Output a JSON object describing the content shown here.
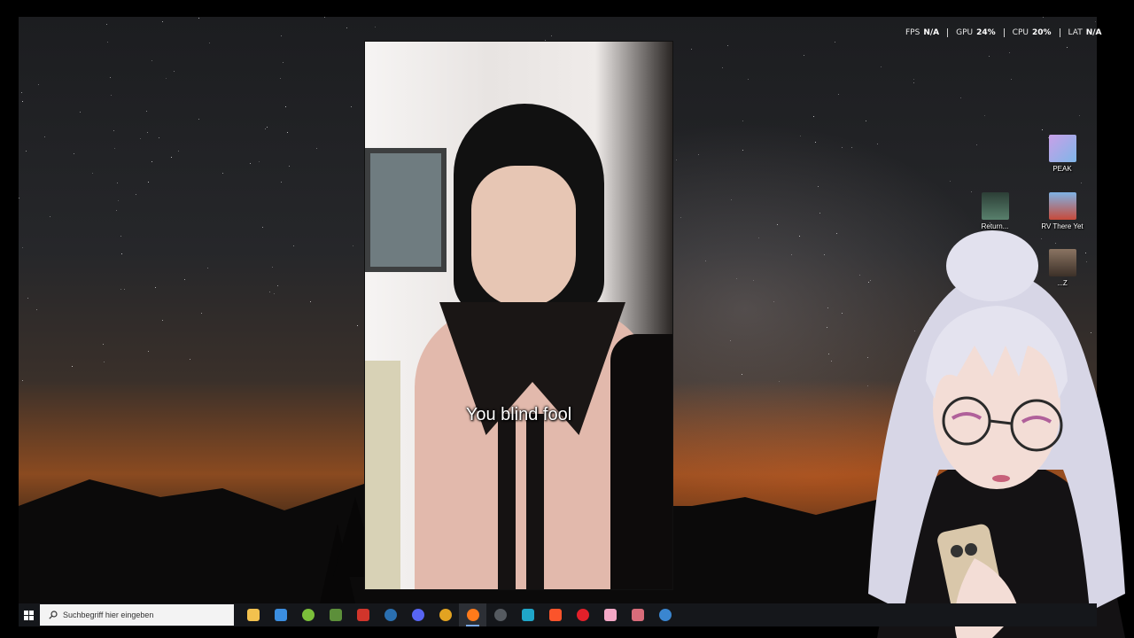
{
  "performance_overlay": {
    "items": [
      {
        "label": "FPS",
        "value": "N/A"
      },
      {
        "label": "GPU",
        "value": "24%"
      },
      {
        "label": "CPU",
        "value": "20%"
      },
      {
        "label": "LAT",
        "value": "N/A"
      }
    ]
  },
  "video": {
    "subtitle": "You blind fool"
  },
  "desktop_icons": [
    {
      "label": "PEAK",
      "icon": "peak-game-icon",
      "color": "#b07ad6"
    },
    {
      "label": "RV There Yet",
      "icon": "rv-there-yet-game-icon",
      "color": "#6fa5d8"
    },
    {
      "label": "Return...",
      "icon": "return-game-icon",
      "color": "#3d5a4a"
    },
    {
      "label": "...Z",
      "icon": "game-shortcut-icon",
      "color": "#6b5848"
    }
  ],
  "taskbar": {
    "search_placeholder": "Suchbegriff hier eingeben",
    "apps": [
      {
        "name": "file-explorer",
        "icon": "folder-icon",
        "color": "#f2c14e"
      },
      {
        "name": "ms-store",
        "icon": "store-icon",
        "color": "#3b8ee0"
      },
      {
        "name": "android-app",
        "icon": "android-icon",
        "color": "#7bbf3a"
      },
      {
        "name": "minecraft",
        "icon": "grass-block-icon",
        "color": "#5c8f3a"
      },
      {
        "name": "magix-writer",
        "icon": "magix-icon",
        "color": "#d1352b"
      },
      {
        "name": "steam",
        "icon": "steam-icon",
        "color": "#2a6fb0"
      },
      {
        "name": "discord",
        "icon": "discord-icon",
        "color": "#5865f2"
      },
      {
        "name": "chrome",
        "icon": "chrome-icon",
        "color": "#e2a321"
      },
      {
        "name": "firefox",
        "icon": "firefox-icon",
        "color": "#ff7a1a",
        "active": true
      },
      {
        "name": "obs",
        "icon": "obs-icon",
        "color": "#555a60"
      },
      {
        "name": "app-blue",
        "icon": "app-blue-icon",
        "color": "#1fa6c9"
      },
      {
        "name": "brave",
        "icon": "brave-icon",
        "color": "#fb542b"
      },
      {
        "name": "opera",
        "icon": "opera-icon",
        "color": "#e3202a"
      },
      {
        "name": "pink-app",
        "icon": "pink-heart-icon",
        "color": "#f4a8c6"
      },
      {
        "name": "tool-app",
        "icon": "tool-icon",
        "color": "#d86c7a"
      },
      {
        "name": "steam-2",
        "icon": "steam-icon",
        "color": "#3a86d0"
      }
    ]
  }
}
